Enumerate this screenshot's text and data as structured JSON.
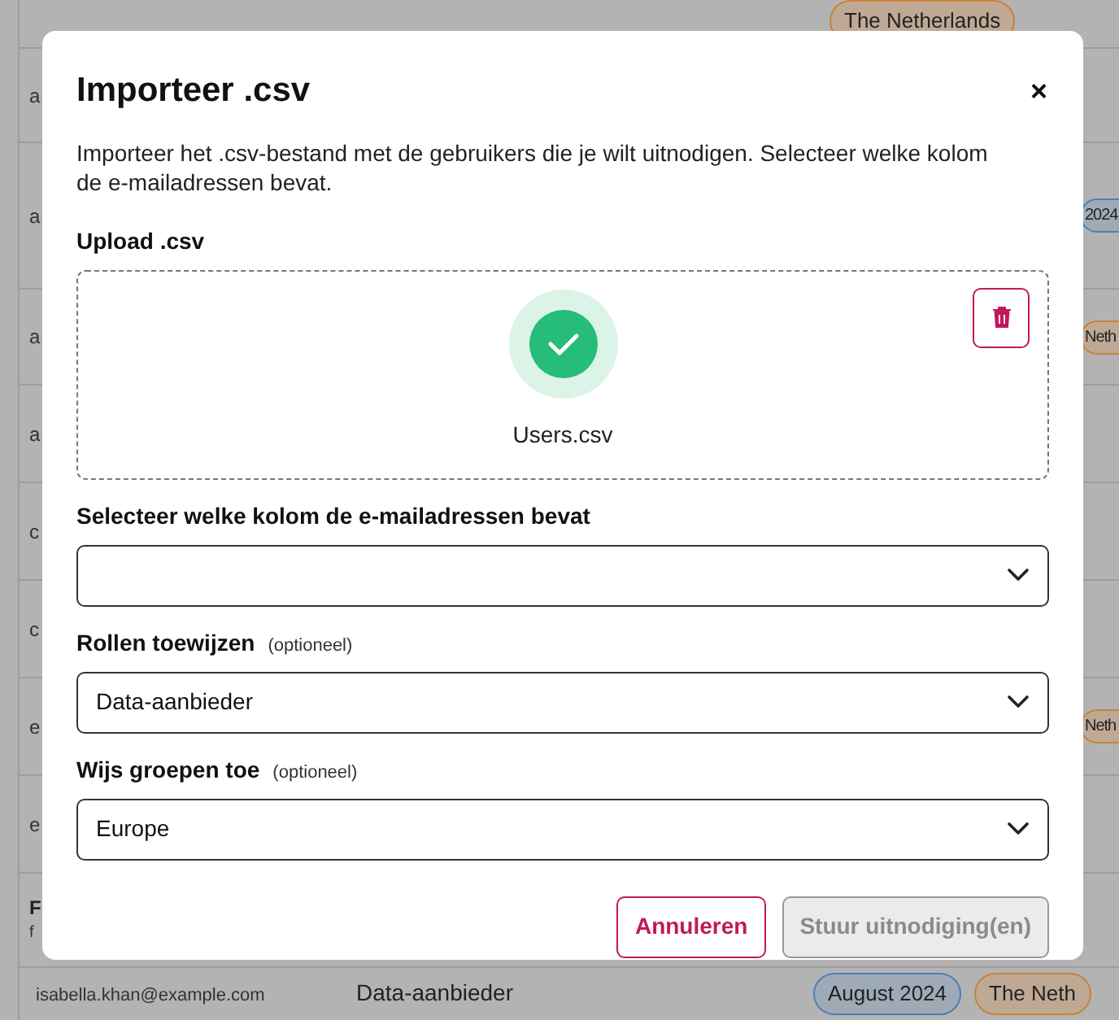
{
  "background": {
    "rows": [
      {
        "kind": "top",
        "cells": [],
        "tags": [
          {
            "text": "The Netherlands",
            "kind": "country"
          }
        ]
      },
      {
        "kind": "cut",
        "cells": [
          "a"
        ],
        "tags": []
      },
      {
        "kind": "cut",
        "cells": [
          "a"
        ],
        "tags": [
          {
            "text": "2024",
            "kind": "date"
          }
        ]
      },
      {
        "kind": "cut",
        "cells": [
          "a"
        ],
        "tags": [
          {
            "text": "Neth",
            "kind": "country"
          }
        ]
      },
      {
        "kind": "cut",
        "cells": [
          "a"
        ],
        "tags": []
      },
      {
        "kind": "cut",
        "cells": [
          "c"
        ],
        "tags": []
      },
      {
        "kind": "cut",
        "cells": [
          "c"
        ],
        "tags": []
      },
      {
        "kind": "cut",
        "cells": [
          "e"
        ],
        "tags": [
          {
            "text": "Neth",
            "kind": "country"
          }
        ]
      },
      {
        "kind": "cut",
        "cells": [
          "e"
        ],
        "tags": []
      },
      {
        "kind": "heading",
        "title": "F",
        "subtitle": "f",
        "tags": []
      },
      {
        "kind": "full",
        "cells": [
          "isabella.khan@example.com",
          "Data-aanbieder"
        ],
        "tags": [
          {
            "text": "August 2024",
            "kind": "date"
          },
          {
            "text": "The Neth",
            "kind": "country"
          }
        ]
      }
    ]
  },
  "dialog": {
    "title": "Importeer .csv",
    "close": "×",
    "description": "Importeer het .csv-bestand met de gebruikers die je wilt uitnodigen. Selecteer welke kolom de e-mailadressen bevat.",
    "upload": {
      "label": "Upload .csv",
      "file_name": "Users.csv",
      "uploaded": true
    },
    "fields": [
      {
        "label": "Selecteer welke kolom de e-mailadressen bevat"
      },
      {
        "label": "Rollen toewijzen",
        "hint": "(optioneel)",
        "value": "Data-aanbieder"
      },
      {
        "label": "Wijs groepen toe",
        "hint": "(optioneel)",
        "value": "Europe"
      }
    ],
    "buttons": [
      {
        "label": "Annuleren",
        "kind": "secondary",
        "disabled": false
      },
      {
        "label": "Stuur uitnodiging(en)",
        "kind": "primary",
        "disabled": true
      }
    ]
  }
}
